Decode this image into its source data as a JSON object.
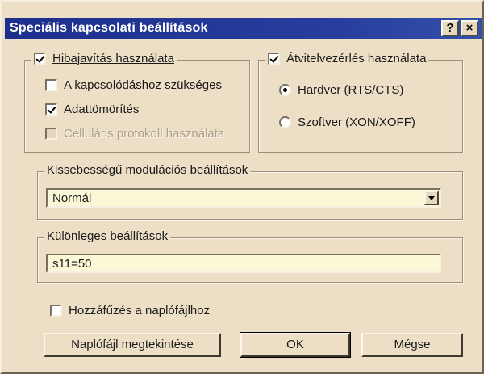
{
  "dialog": {
    "title": "Speciális kapcsolati beállítások",
    "help_button": "?",
    "close_button": "×"
  },
  "error_correction": {
    "label": "Hibajavítás használata",
    "checked": true,
    "options": [
      {
        "label": "A kapcsolódáshoz szükséges",
        "checked": false,
        "disabled": false
      },
      {
        "label": "Adattömörítés",
        "checked": true,
        "disabled": false
      },
      {
        "label": "Celluláris protokoll használata",
        "checked": false,
        "disabled": true
      }
    ]
  },
  "flow_control": {
    "label": "Átvitelvezérlés használata",
    "checked": true,
    "options": [
      {
        "label": "Hardver (RTS/CTS)",
        "selected": true
      },
      {
        "label": "Szoftver (XON/XOFF)",
        "selected": false
      }
    ]
  },
  "modulation": {
    "label": "Kissebességű modulációs beállítások",
    "selected_value": "Normál"
  },
  "extra_settings": {
    "label": "Különleges beállítások",
    "value": "s11=50"
  },
  "append_log": {
    "label": "Hozzáfűzés a naplófájlhoz",
    "checked": false
  },
  "buttons": {
    "view_log": "Naplófájl megtekintése",
    "ok": "OK",
    "cancel": "Mégse"
  },
  "colors": {
    "titlebar": "#1c2f8c",
    "dialog_bg": "#ecdfc6",
    "field_bg": "#fbf8d8"
  }
}
